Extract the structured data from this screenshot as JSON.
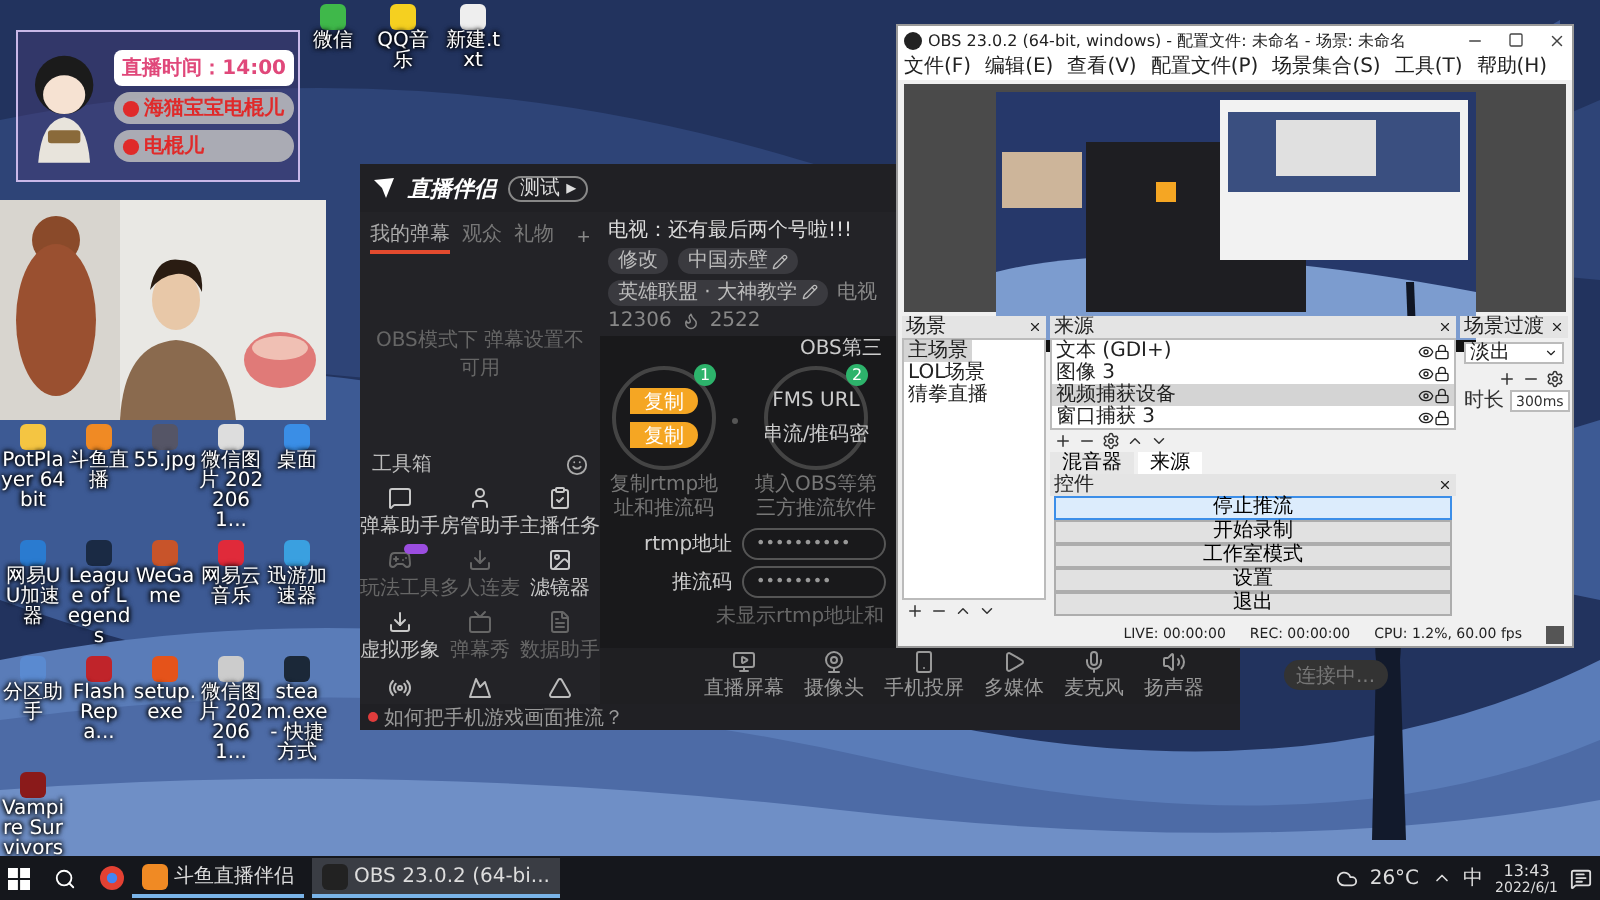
{
  "desktop": {
    "top_icons": [
      {
        "label": "微信"
      },
      {
        "label": "QQ音乐"
      },
      {
        "label": "新建.txt"
      }
    ],
    "icons": [
      {
        "label": "PotPlayer 64 bit"
      },
      {
        "label": "斗鱼直播"
      },
      {
        "label": "55.jpg"
      },
      {
        "label": "微信图片 2022061..."
      },
      {
        "label": "桌面"
      },
      {
        "label": "网易UU加速器"
      },
      {
        "label": "League of Legends"
      },
      {
        "label": "WeGame"
      },
      {
        "label": "网易云音乐"
      },
      {
        "label": "迅游加速器"
      },
      {
        "label": "分区助手"
      },
      {
        "label": "Flash Repa..."
      },
      {
        "label": "setup.exe"
      },
      {
        "label": "微信图片 2022061..."
      },
      {
        "label": "steam.exe - 快捷方式"
      },
      {
        "label": "Vampire Survivors"
      }
    ]
  },
  "stream_overlay": {
    "timer": "直播时间：14:00",
    "lines": [
      "海猫宝宝电棍儿",
      "电棍儿"
    ]
  },
  "companion": {
    "app_name": "直播伴侣",
    "test_button": "测试 ▸",
    "tabs": [
      {
        "label": "我的弹幕",
        "selected": true
      },
      {
        "label": "观众",
        "selected": false
      },
      {
        "label": "礼物",
        "selected": false
      }
    ],
    "add_tab": "+",
    "notice": "OBS模式下 弹幕设置不可用",
    "toolbox_title": "工具箱",
    "tools": [
      {
        "label": "弹幕助手",
        "disabled": false,
        "badge": false
      },
      {
        "label": "房管助手",
        "disabled": false,
        "badge": false
      },
      {
        "label": "主播任务",
        "disabled": false,
        "badge": false
      },
      {
        "label": "玩法工具",
        "disabled": true,
        "badge": true
      },
      {
        "label": "多人连麦",
        "disabled": true,
        "badge": false
      },
      {
        "label": "滤镜器",
        "disabled": false,
        "badge": false
      },
      {
        "label": "虚拟形象",
        "disabled": false,
        "badge": false
      },
      {
        "label": "弹幕秀",
        "disabled": true,
        "badge": false
      },
      {
        "label": "数据助手",
        "disabled": true,
        "badge": false
      }
    ],
    "room_title": "电视：还有最后两个号啦!!!",
    "edit_button": "修改",
    "category": "中国赤壁",
    "tag": "英雄联盟 · 大神教学",
    "room_label": "电视",
    "room_number": "12306",
    "heat": "2522",
    "obs_heading": "OBS第三",
    "steps": [
      {
        "number": "1",
        "caption": "复制rtmp地址和推流码",
        "items": [
          "复制",
          "复制"
        ]
      },
      {
        "number": "2",
        "caption": "填入OBS等第三方推流软件",
        "items": [
          "FMS URL",
          "串流/推码密"
        ]
      }
    ],
    "fields": [
      {
        "label": "rtmp地址",
        "value": "••••••••••"
      },
      {
        "label": "推流码",
        "value": "••••••••"
      }
    ],
    "hint": "未显示rtmp地址和",
    "bottom_tools": [
      "直播屏幕",
      "摄像头",
      "手机投屏",
      "多媒体",
      "麦克风",
      "扬声器"
    ],
    "connect_button": "连接中...",
    "footer": "如何把手机游戏画面推流？"
  },
  "obs": {
    "title": "OBS 23.0.2 (64-bit, windows) - 配置文件: 未命名 - 场景: 未命名",
    "menu": [
      "文件(F)",
      "编辑(E)",
      "查看(V)",
      "配置文件(P)",
      "场景集合(S)",
      "工具(T)",
      "帮助(H)"
    ],
    "scenes": {
      "title": "场景",
      "items": [
        {
          "label": "主场景",
          "selected": true
        },
        {
          "label": "LOL场景",
          "selected": false
        },
        {
          "label": "猜拳直播",
          "selected": false
        }
      ]
    },
    "sources": {
      "title": "来源",
      "items": [
        {
          "label": "文本 (GDI+)",
          "selected": false
        },
        {
          "label": "图像 3",
          "selected": false
        },
        {
          "label": "视频捕获设备",
          "selected": true
        },
        {
          "label": "窗口捕获 3",
          "selected": false
        }
      ]
    },
    "tabs": [
      {
        "label": "混音器",
        "selected": false
      },
      {
        "label": "来源",
        "selected": true
      }
    ],
    "controls": {
      "title": "控件",
      "buttons": [
        {
          "label": "停止推流",
          "highlighted": true
        },
        {
          "label": "开始录制",
          "highlighted": false
        },
        {
          "label": "工作室模式",
          "highlighted": false
        },
        {
          "label": "设置",
          "highlighted": false
        },
        {
          "label": "退出",
          "highlighted": false
        }
      ]
    },
    "transitions": {
      "title": "场景过渡",
      "select": "淡出",
      "duration_label": "时长",
      "duration": "300ms"
    },
    "status": [
      "LIVE: 00:00:00",
      "REC: 00:00:00",
      "CPU: 1.2%, 60.00 fps"
    ]
  },
  "taskbar": {
    "apps": [
      {
        "label": "斗鱼直播伴侣",
        "active": false
      },
      {
        "label": "OBS 23.0.2 (64-bi...",
        "active": true
      }
    ],
    "weather": "26°C",
    "ime": "中",
    "time": "13:43",
    "date": "2022/6/1"
  }
}
